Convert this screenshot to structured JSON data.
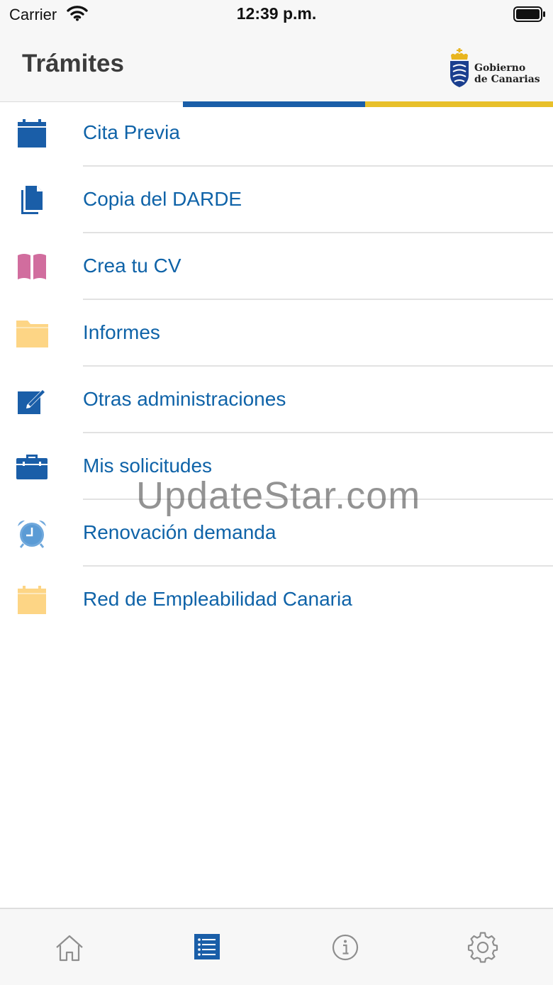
{
  "status_bar": {
    "carrier": "Carrier",
    "time": "12:39 p.m."
  },
  "header": {
    "title": "Trámites",
    "logo_line1": "Gobierno",
    "logo_line2": "de Canarias"
  },
  "colors": {
    "accent_blue": "#1a5ea8",
    "accent_yellow": "#e8c02a",
    "link_blue": "#0f63a8",
    "pink": "#d16d9e",
    "folder_yellow": "#fdd585"
  },
  "list": [
    {
      "label": "Cita Previa",
      "icon": "calendar-icon"
    },
    {
      "label": "Copia del DARDE",
      "icon": "document-copy-icon"
    },
    {
      "label": "Crea tu CV",
      "icon": "book-icon"
    },
    {
      "label": "Informes",
      "icon": "folder-icon"
    },
    {
      "label": "Otras administraciones",
      "icon": "edit-icon"
    },
    {
      "label": "Mis solicitudes",
      "icon": "briefcase-icon"
    },
    {
      "label": "Renovación demanda",
      "icon": "alarm-clock-icon"
    },
    {
      "label": "Red de Empleabilidad Canaria",
      "icon": "calendar-yellow-icon"
    }
  ],
  "watermark": "UpdateStar.com",
  "tabbar": {
    "selected": "list",
    "tabs": [
      {
        "name": "home",
        "icon": "home-icon"
      },
      {
        "name": "list",
        "icon": "list-icon"
      },
      {
        "name": "info",
        "icon": "info-icon"
      },
      {
        "name": "settings",
        "icon": "gear-icon"
      }
    ]
  }
}
